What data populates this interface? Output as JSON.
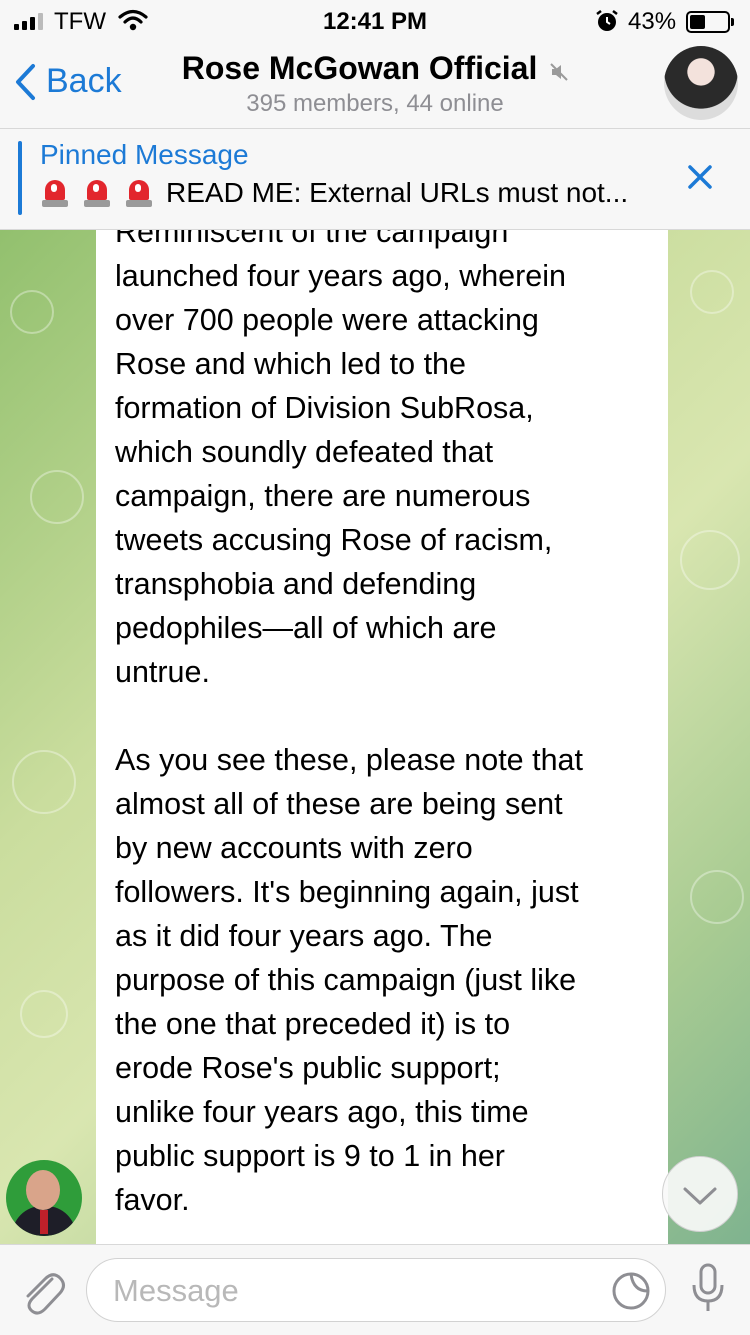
{
  "status_bar": {
    "carrier": "TFW",
    "time": "12:41 PM",
    "battery": "43%",
    "battery_level": 0.43
  },
  "nav": {
    "back_label": "Back",
    "title": "Rose McGowan Official",
    "subtitle": "395 members, 44 online",
    "muted": true
  },
  "pinned": {
    "label": "Pinned Message",
    "text": "READ ME: External URLs must not..."
  },
  "message": {
    "paragraph1": "Reminiscent of the campaign\nlaunched four years ago, wherein\nover 700 people were attacking\nRose and which led to the\nformation of Division SubRosa,\nwhich soundly defeated that\ncampaign, there are numerous\ntweets accusing Rose of racism,\ntransphobia and defending\npedophiles—all of which are\nuntrue.",
    "paragraph2": "As you see these, please note that\nalmost all of these are being sent\nby new accounts with zero\nfollowers. It's beginning again, just\nas it did four years ago. The\npurpose of this campaign (just like\nthe one that preceded it) is to\nerode Rose's public support;\nunlike four years ago, this time\npublic support is 9 to 1 in her\nfavor."
  },
  "input": {
    "placeholder": "Message"
  },
  "colors": {
    "accent": "#1c7ad6",
    "bar_bg": "#f7f7f7"
  }
}
